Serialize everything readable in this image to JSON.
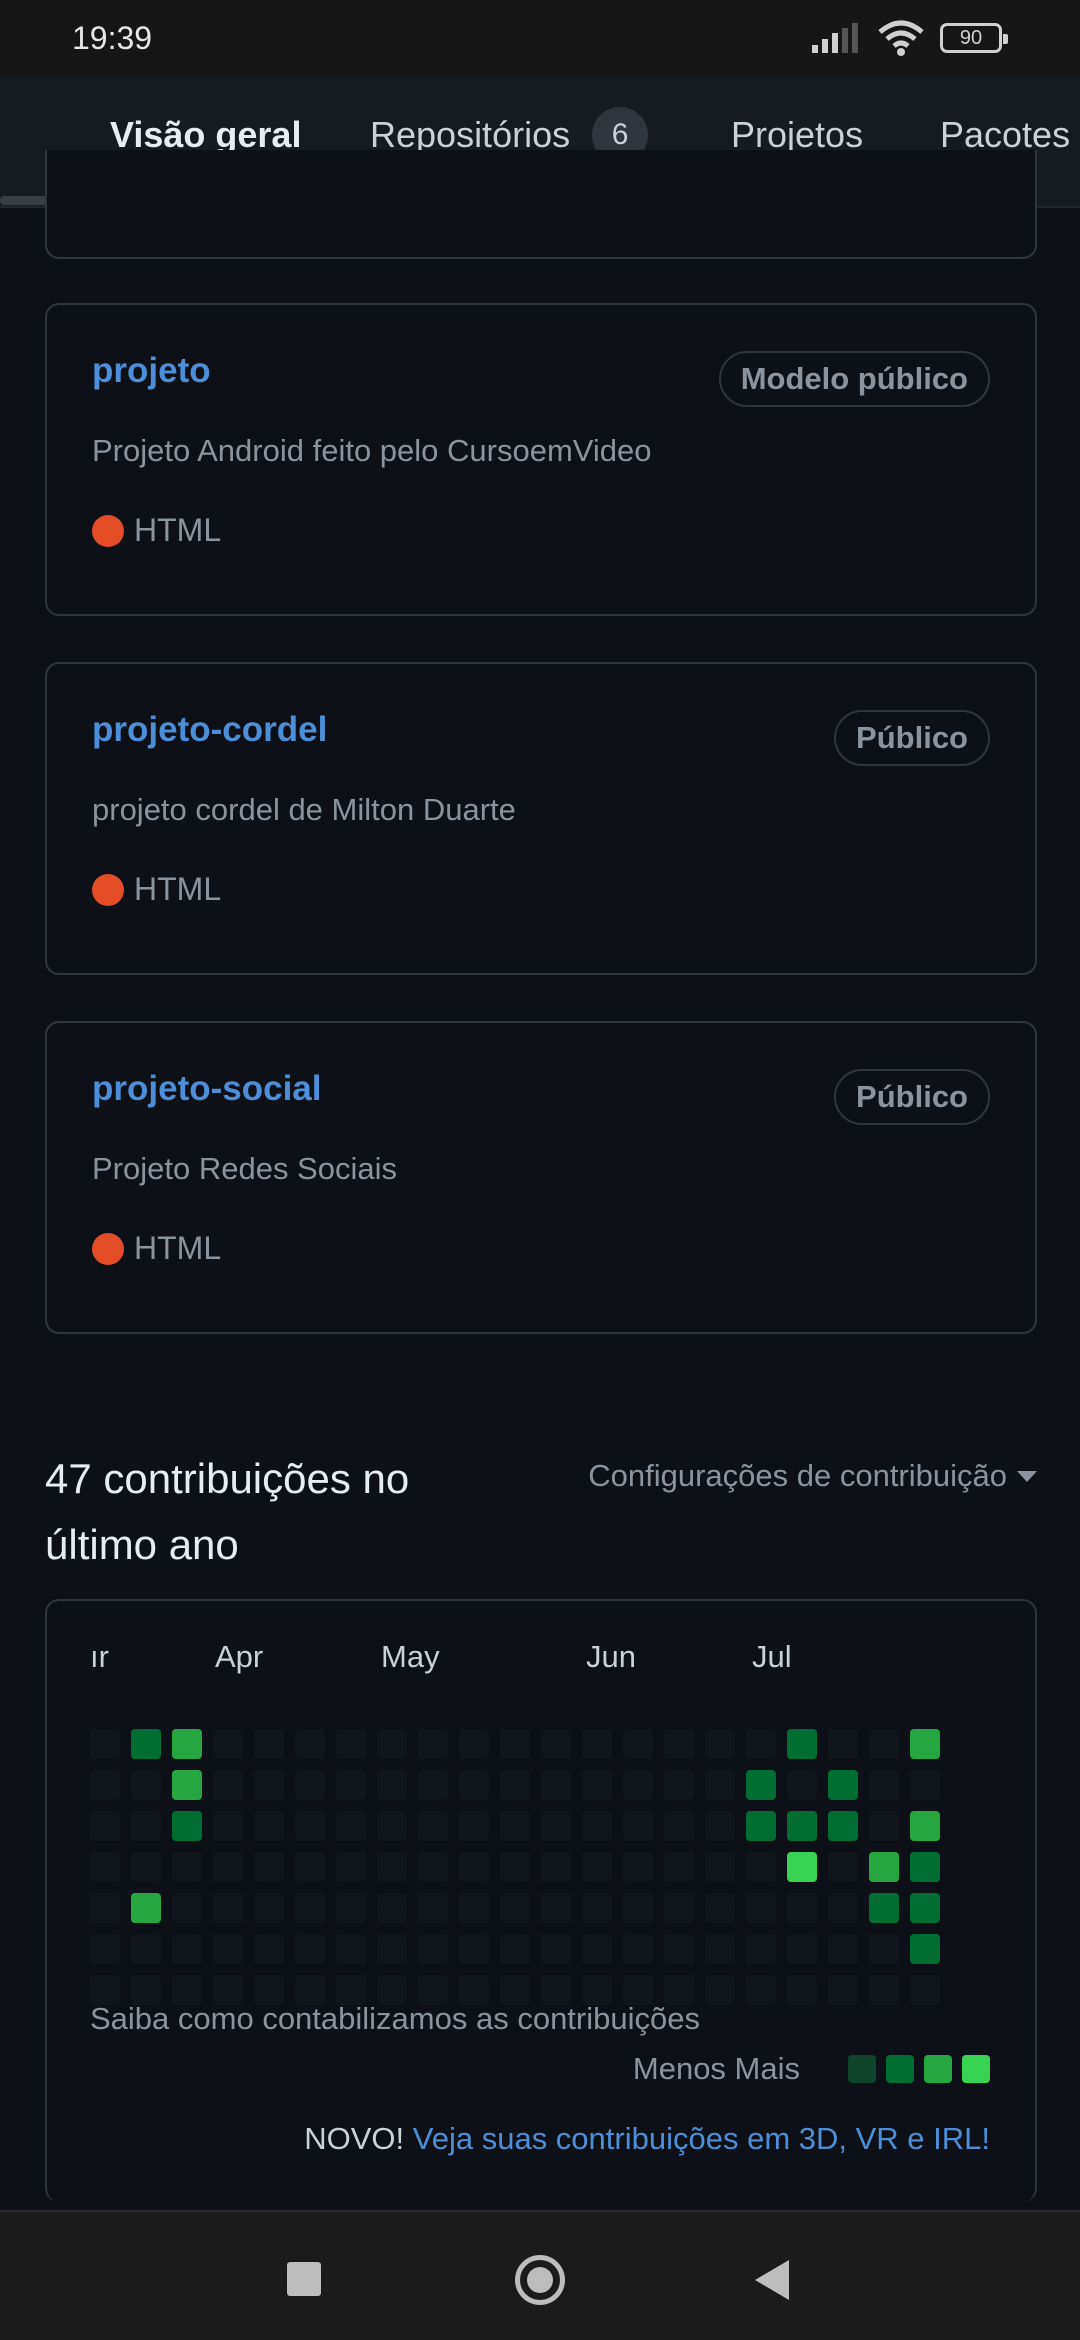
{
  "status_bar": {
    "time": "19:39",
    "battery": "90"
  },
  "tabs": [
    {
      "label": "Visão geral",
      "active": true
    },
    {
      "label": "Repositórios",
      "count": "6"
    },
    {
      "label": "Projetos"
    },
    {
      "label": "Pacotes"
    }
  ],
  "repos": [
    {
      "name": "projeto",
      "badge": "Modelo público",
      "description": "Projeto Android feito pelo CursoemVideo",
      "language": "HTML"
    },
    {
      "name": "projeto-cordel",
      "badge": "Público",
      "description": "projeto cordel de Milton Duarte",
      "language": "HTML"
    },
    {
      "name": "projeto-social",
      "badge": "Público",
      "description": "Projeto Redes Sociais",
      "language": "HTML"
    }
  ],
  "contributions": {
    "title": "47 contribuições no último ano",
    "settings_label": "Configurações de contribuição",
    "months": [
      "ır",
      "Apr",
      "May",
      "Jun",
      "Jul"
    ],
    "learn_link": "Saiba como contabilizamos as contribuições",
    "legend_label": "Menos Mais",
    "new_prefix": "NOVO!",
    "new_link": "Veja suas contribuições em 3D, VR e IRL!"
  },
  "colors": {
    "link": "#4c8ed8",
    "lang_html": "#e34c26",
    "tab_indicator": "#f78166",
    "contrib_levels": [
      "#161b22",
      "#0e4429",
      "#006d32",
      "#26a641",
      "#39d353"
    ]
  }
}
